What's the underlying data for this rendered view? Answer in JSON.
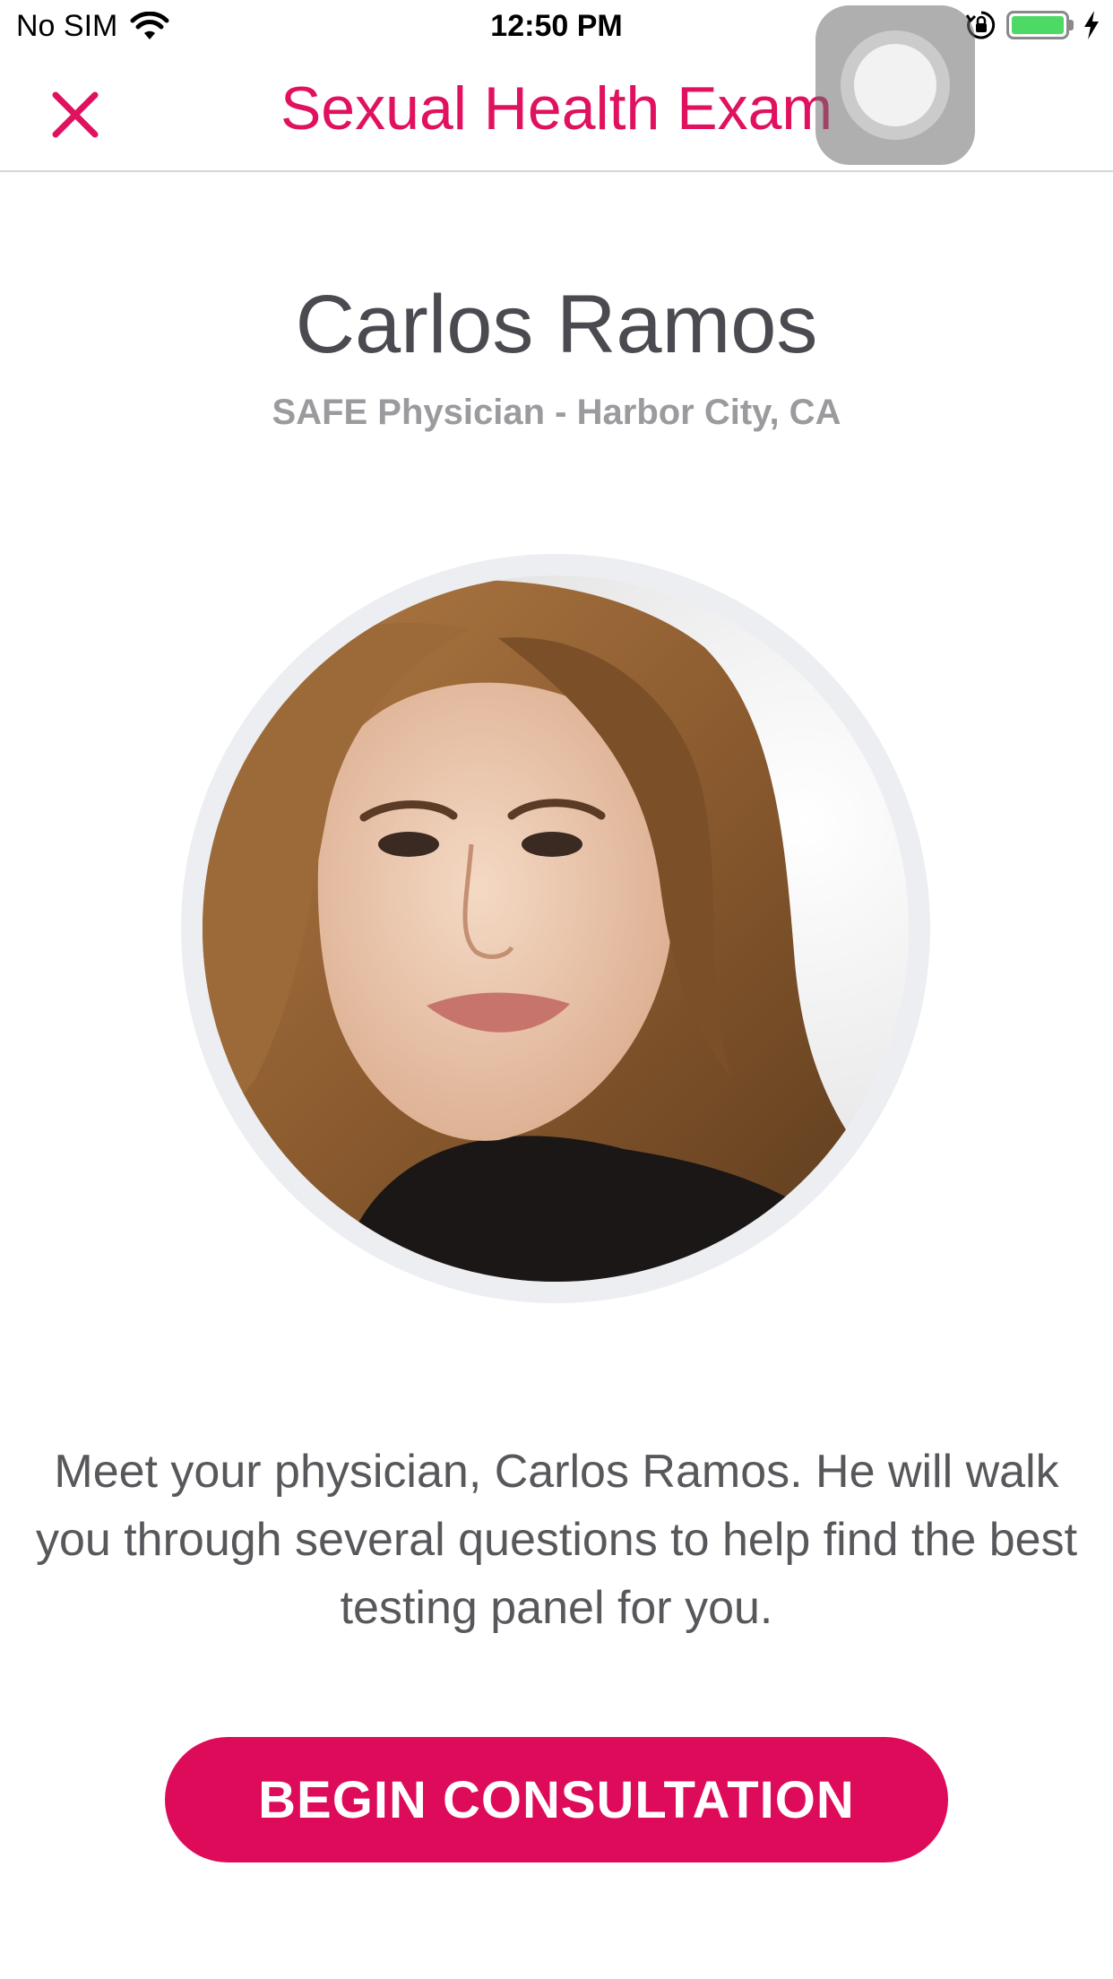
{
  "status_bar": {
    "carrier": "No SIM",
    "time": "12:50 PM",
    "wifi_icon": "wifi-icon",
    "orientation_lock_icon": "orientation-lock-icon",
    "battery_icon": "battery-icon",
    "charging_icon": "charging-bolt-icon",
    "battery_level": 1.0
  },
  "nav": {
    "title": "Sexual Health Exam",
    "close_icon": "close-icon"
  },
  "physician": {
    "name": "Carlos Ramos",
    "subtitle": "SAFE Physician - Harbor City, CA"
  },
  "description": "Meet your physician, Carlos Ramos. He will walk you through several questions to help find the best testing panel for you.",
  "cta": {
    "label": "BEGIN CONSULTATION"
  },
  "colors": {
    "accent": "#e0115f",
    "button": "#de0a5a",
    "name_text": "#4a4a50",
    "subtitle_text": "#9b9b9f",
    "body_text": "#58585c",
    "battery_fill": "#4cd964"
  }
}
